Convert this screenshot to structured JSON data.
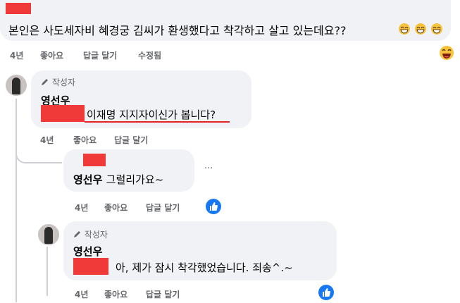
{
  "top_comment": {
    "text": "본인은 사도세자비 혜경궁 김씨가 환생했다고 착각하고 살고 있는데요??",
    "meta": {
      "time": "4년",
      "like": "좋아요",
      "reply": "답글 달기",
      "edited": "수정됨"
    }
  },
  "reply1": {
    "badge": "작성자",
    "author": "영선우",
    "text": "이재명 지지자이신가 봅니다?",
    "meta": {
      "time": "4년",
      "like": "좋아요",
      "reply": "답글 달기"
    }
  },
  "reply2": {
    "author": "영선우",
    "text": "그럴리가요~",
    "more": "···",
    "meta": {
      "time": "4년",
      "like": "좋아요",
      "reply": "답글 달기"
    }
  },
  "reply3": {
    "badge": "작성자",
    "author": "영선우",
    "text": "아, 제가 잠시 착각했었습니다. 죄송^.~",
    "meta": {
      "time": "4년",
      "like": "좋아요",
      "reply": "답글 달기"
    }
  },
  "colors": {
    "redact": "#f03a3a",
    "bubble": "#f0f2f5",
    "underline": "#e0242a",
    "like_blue": "#1877f2",
    "meta_gray": "#65676b"
  },
  "icons": [
    "grin-emoji",
    "pen-icon",
    "like-reaction-icon"
  ]
}
